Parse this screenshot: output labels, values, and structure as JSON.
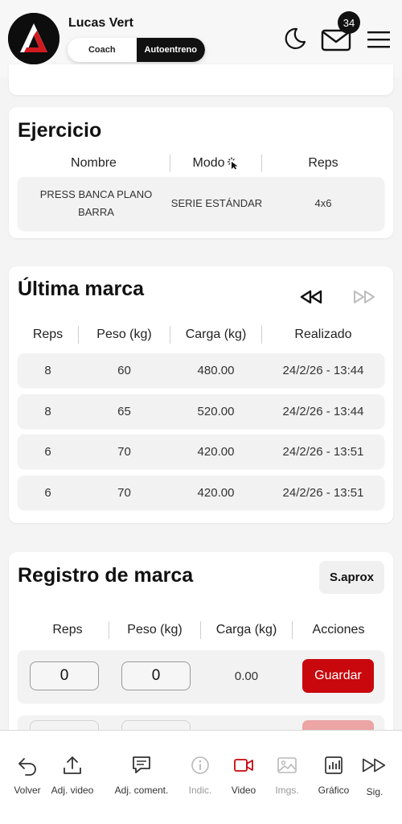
{
  "header": {
    "user_name": "Lucas Vert",
    "mode_options": [
      "Coach",
      "Autoentreno"
    ],
    "active_mode": "Autoentreno",
    "notifications_count": "34",
    "icons": [
      "moon-icon",
      "mail-icon",
      "hamburger-menu-icon"
    ],
    "accent_color": "#c8080d"
  },
  "exercise": {
    "title": "Ejercicio",
    "columns": [
      "Nombre",
      "Modo",
      "Reps"
    ],
    "row": {
      "name": "PRESS BANCA PLANO BARRA",
      "mode": "SERIE ESTÁNDAR",
      "reps": "4x6"
    }
  },
  "last_mark": {
    "title": "Última marca",
    "columns": [
      "Reps",
      "Peso (kg)",
      "Carga (kg)",
      "Realizado"
    ],
    "rows": [
      {
        "reps": "8",
        "peso": "60",
        "carga": "480.00",
        "realizado": "24/2/26 - 13:44"
      },
      {
        "reps": "8",
        "peso": "65",
        "carga": "520.00",
        "realizado": "24/2/26 - 13:44"
      },
      {
        "reps": "6",
        "peso": "70",
        "carga": "420.00",
        "realizado": "24/2/26 - 13:51"
      },
      {
        "reps": "6",
        "peso": "70",
        "carga": "420.00",
        "realizado": "24/2/26 - 13:51"
      }
    ]
  },
  "register": {
    "title": "Registro de marca",
    "saprox_label": "S.aprox",
    "columns": [
      "Reps",
      "Peso (kg)",
      "Carga (kg)",
      "Acciones"
    ],
    "row": {
      "reps": "0",
      "peso": "0",
      "carga": "0.00",
      "save_label": "Guardar"
    }
  },
  "toolbar": {
    "items": [
      {
        "label": "Volver",
        "icon": "back-arrow-icon"
      },
      {
        "label": "Adj. video",
        "icon": "upload-icon"
      },
      {
        "label": "Adj. coment.",
        "icon": "comment-icon"
      },
      {
        "label": "Indic.",
        "icon": "info-icon"
      },
      {
        "label": "Video",
        "icon": "video-camera-icon"
      },
      {
        "label": "Imgs.",
        "icon": "image-icon"
      },
      {
        "label": "Gráfico",
        "icon": "bar-chart-icon"
      },
      {
        "label": "Sig.",
        "icon": "fast-forward-icon"
      }
    ]
  }
}
